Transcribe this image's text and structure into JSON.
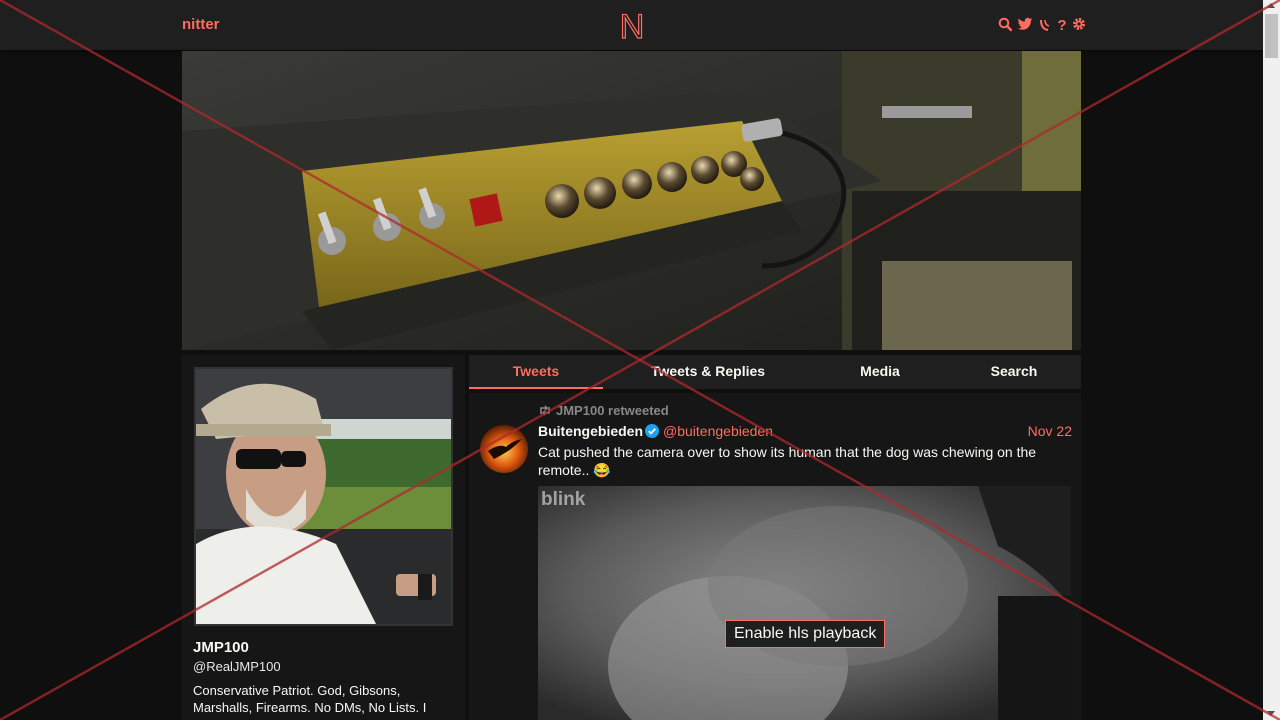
{
  "navbar": {
    "brand": "nitter",
    "logo_letter": "N",
    "icons": [
      "search-icon",
      "twitter-icon",
      "rss-icon",
      "help-icon",
      "gear-icon"
    ]
  },
  "profile": {
    "fullname": "JMP100",
    "username": "@RealJMP100",
    "bio": "Conservative Patriot. God, Gibsons, Marshalls, Firearms. No DMs, No Lists. I"
  },
  "tabs": [
    {
      "label": "Tweets",
      "active": true
    },
    {
      "label": "Tweets & Replies",
      "active": false
    },
    {
      "label": "Media",
      "active": false
    },
    {
      "label": "Search",
      "active": false
    }
  ],
  "tweet": {
    "retweet_header": "JMP100 retweeted",
    "fullname": "Buitengebieden",
    "username": "@buitengebieden",
    "date": "Nov 22",
    "text": "Cat pushed the camera over to show its human that the dog was chewing on the remote.. 😂",
    "media_watermark": "blink",
    "media_button": "Enable hls playback"
  },
  "colors": {
    "accent": "#ff6c60",
    "background": "#0f0f0f",
    "panel": "#161616",
    "navbar": "#1f1f1f",
    "muted": "#888889"
  }
}
